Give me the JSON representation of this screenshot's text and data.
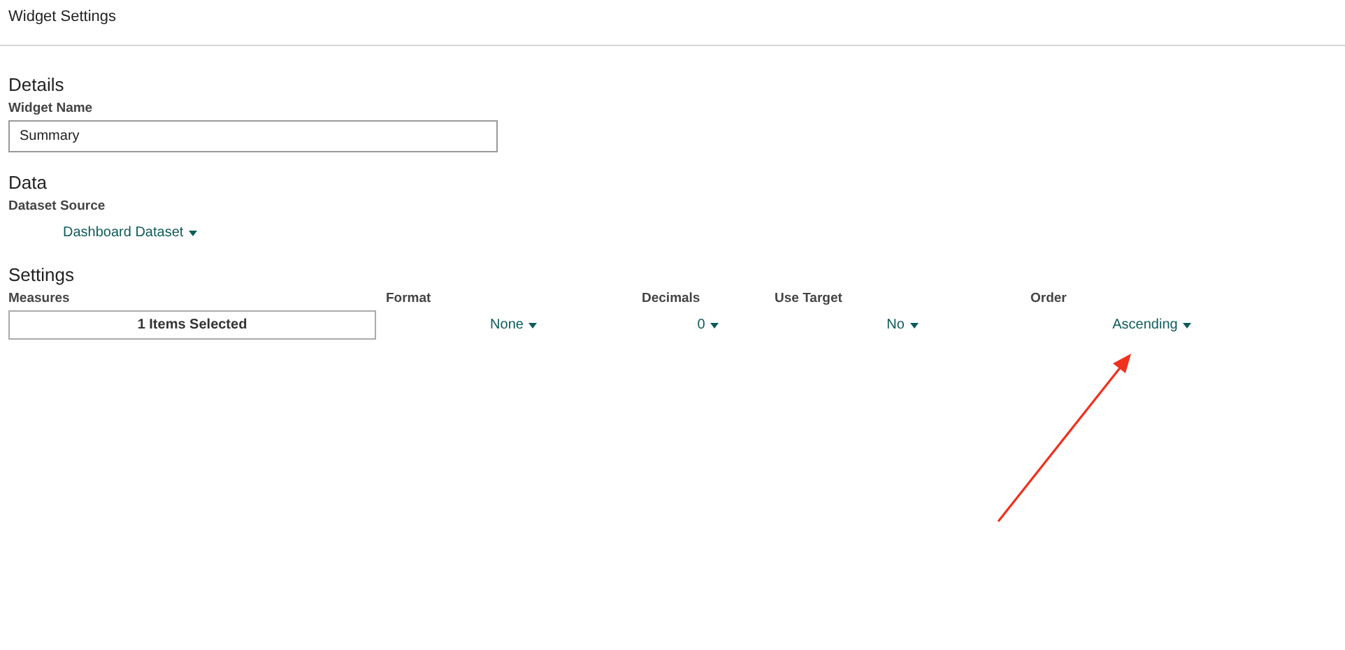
{
  "window": {
    "title": "Widget Settings"
  },
  "details": {
    "heading": "Details",
    "widget_name": {
      "label": "Widget Name",
      "value": "Summary"
    }
  },
  "data": {
    "heading": "Data",
    "dataset_source": {
      "label": "Dataset Source",
      "value": "Dashboard Dataset"
    }
  },
  "settings": {
    "heading": "Settings",
    "columns": [
      {
        "kind": "multiselect",
        "label": "Measures",
        "value": "1 Items Selected"
      },
      {
        "kind": "dropdown",
        "label": "Format",
        "value": "None"
      },
      {
        "kind": "dropdown",
        "label": "Decimals",
        "value": "0"
      },
      {
        "kind": "dropdown",
        "label": "Use Target",
        "value": "No"
      },
      {
        "kind": "dropdown",
        "label": "Order",
        "value": "Ascending"
      }
    ]
  }
}
